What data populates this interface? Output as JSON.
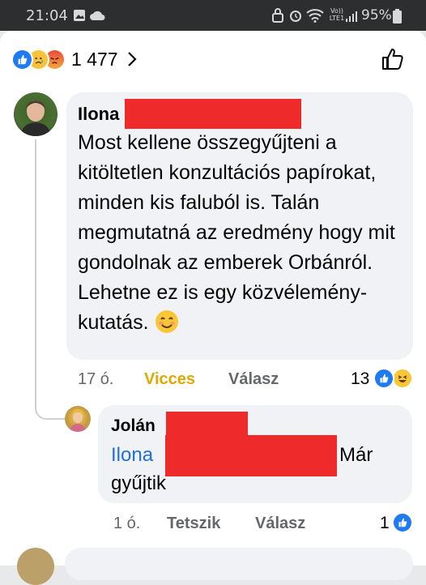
{
  "status_bar": {
    "time": "21:04",
    "battery": "95%",
    "network": "Vo)) LTE1"
  },
  "reactions": {
    "count": "1 477",
    "types": [
      "like-icon",
      "sad-icon",
      "angry-icon"
    ]
  },
  "comments": [
    {
      "author": "Ilona",
      "text": "Most kellene összegyűjteni a kitöltetlen konzultációs papírokat, minden kis faluból is. Talán megmutatná az eredmény hogy mit gondolnak az emberek Orbánról. Lehetne ez is egy közvélemény-kutatás.",
      "time": "17 ó.",
      "reaction_label": "Vicces",
      "reply_label": "Válasz",
      "reaction_count": "13",
      "reaction_colors": {
        "reacted": "#e0a800"
      }
    },
    {
      "author": "Jolán",
      "mention": "Ilona",
      "text_after": "Már",
      "text_line2": "gyűjtik",
      "time": "1 ó.",
      "reaction_label": "Tetszik",
      "reply_label": "Válasz",
      "reaction_count": "1"
    }
  ],
  "colors": {
    "like_blue": "#1f7bf2",
    "mention_blue": "#216fdb",
    "redaction": "#ee2a2a",
    "bubble": "#f0f2f5"
  }
}
